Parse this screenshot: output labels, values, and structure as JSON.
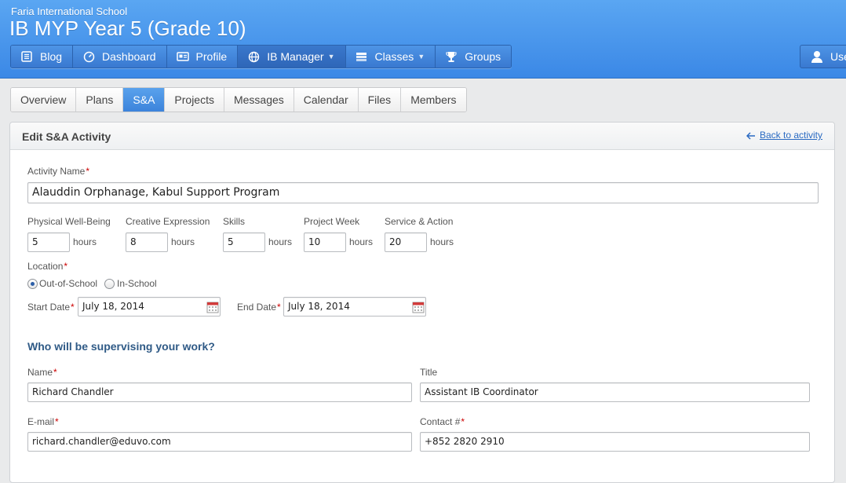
{
  "header": {
    "school": "Faria International School",
    "course": "IB MYP Year 5 (Grade 10)",
    "nav": [
      {
        "label": "Blog",
        "icon": "blog-icon"
      },
      {
        "label": "Dashboard",
        "icon": "dashboard-icon"
      },
      {
        "label": "Profile",
        "icon": "profile-icon"
      },
      {
        "label": "IB Manager",
        "icon": "globe-icon",
        "dropdown": true
      },
      {
        "label": "Classes",
        "icon": "classes-icon",
        "dropdown": true
      },
      {
        "label": "Groups",
        "icon": "trophy-icon"
      }
    ],
    "active_nav": "IB Manager",
    "user_label": "Use"
  },
  "subtabs": {
    "items": [
      "Overview",
      "Plans",
      "S&A",
      "Projects",
      "Messages",
      "Calendar",
      "Files",
      "Members"
    ],
    "active": "S&A"
  },
  "panel": {
    "title": "Edit S&A Activity",
    "back_link": "Back to activity"
  },
  "form": {
    "activity_name_label": "Activity Name",
    "activity_name": "Alauddin Orphanage, Kabul Support Program",
    "hours_unit": "hours",
    "categories": [
      {
        "label": "Physical Well-Being",
        "value": "5"
      },
      {
        "label": "Creative Expression",
        "value": "8"
      },
      {
        "label": "Skills",
        "value": "5"
      },
      {
        "label": "Project Week",
        "value": "10"
      },
      {
        "label": "Service & Action",
        "value": "20"
      }
    ],
    "location_label": "Location",
    "location_options": [
      "Out-of-School",
      "In-School"
    ],
    "location_selected": "Out-of-School",
    "start_date_label": "Start Date",
    "start_date": "July 18, 2014",
    "end_date_label": "End Date",
    "end_date": "July 18, 2014",
    "supervisor_heading": "Who will be supervising your work?",
    "name_label": "Name",
    "name": "Richard Chandler",
    "title_label": "Title",
    "title": "Assistant IB Coordinator",
    "email_label": "E-mail",
    "email": "richard.chandler@eduvo.com",
    "contact_label": "Contact #",
    "contact": "+852 2820 2910"
  },
  "colors": {
    "header_blue": "#3b88e6",
    "active_tab": "#3c83db",
    "link": "#2a6ac2",
    "required": "#cc0000",
    "section_heading": "#2f5a86"
  }
}
